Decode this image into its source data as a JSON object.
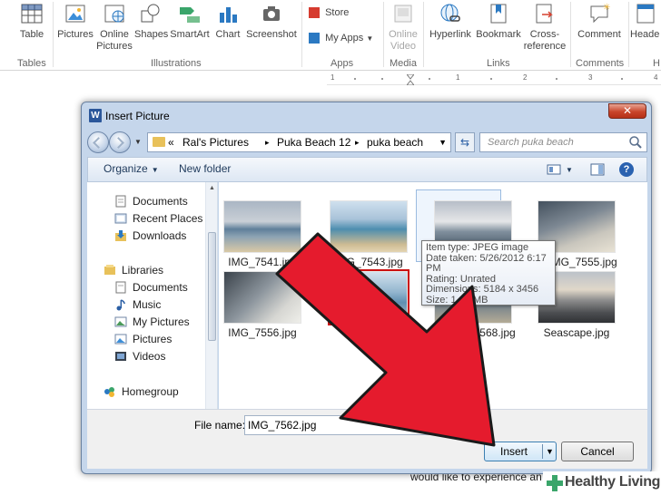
{
  "ribbon": {
    "buttons": {
      "table": "Table",
      "pictures": "Pictures",
      "online_pictures_1": "Online",
      "online_pictures_2": "Pictures",
      "shapes": "Shapes",
      "smartart": "SmartArt",
      "chart": "Chart",
      "screenshot": "Screenshot",
      "store": "Store",
      "my_apps": "My Apps",
      "online_video_1": "Online",
      "online_video_2": "Video",
      "hyperlink": "Hyperlink",
      "bookmark": "Bookmark",
      "cross_ref_1": "Cross-",
      "cross_ref_2": "reference",
      "comment": "Comment",
      "header": "Heade"
    },
    "groups": {
      "tables": "Tables",
      "illustrations": "Illustrations",
      "apps": "Apps",
      "media": "Media",
      "links": "Links",
      "comments": "Comments",
      "h": "H"
    }
  },
  "ruler": {
    "labels": [
      "1",
      "1",
      "2",
      "3",
      "4"
    ]
  },
  "document": {
    "visible_line": "would like to experience an"
  },
  "dialog": {
    "title": "Insert Picture",
    "close_label": "✕",
    "breadcrumb": [
      "«",
      "Ral's Pictures",
      "▸",
      "Puka Beach 12",
      "▸",
      "puka beach"
    ],
    "search_placeholder": "Search puka beach",
    "toolbar": {
      "organize": "Organize",
      "new_folder": "New folder"
    },
    "nav_items": {
      "documents": "Documents",
      "recent_places": "Recent Places",
      "downloads": "Downloads",
      "libraries": "Libraries",
      "lib_documents": "Documents",
      "music": "Music",
      "my_pictures": "My Pictures",
      "pictures": "Pictures",
      "videos": "Videos",
      "homegroup": "Homegroup"
    },
    "files": {
      "f1": "IMG_7541.jpg",
      "f2": "IMG_7543.jpg",
      "f4": "IMG_7555.jpg",
      "f5": "IMG_7556.jpg",
      "f7": "IMG_7568.jpg",
      "f8": "Seascape.jpg"
    },
    "tooltip": {
      "type": "Item type: JPEG image",
      "date": "Date taken: 5/26/2012 6:17 PM",
      "rating": "Rating: Unrated",
      "dims": "Dimensions: 5184 x 3456",
      "size": "Size: 1.15 MB"
    },
    "file_name_label": "File name:",
    "file_name_value": "IMG_7562.jpg",
    "insert_label": "Insert",
    "cancel_label": "Cancel"
  },
  "watermark": {
    "text": "Healthy Living"
  },
  "colors": {
    "accent": "#2b579a",
    "arrow_red": "#e51b2d",
    "selection_red": "#cc1010"
  }
}
